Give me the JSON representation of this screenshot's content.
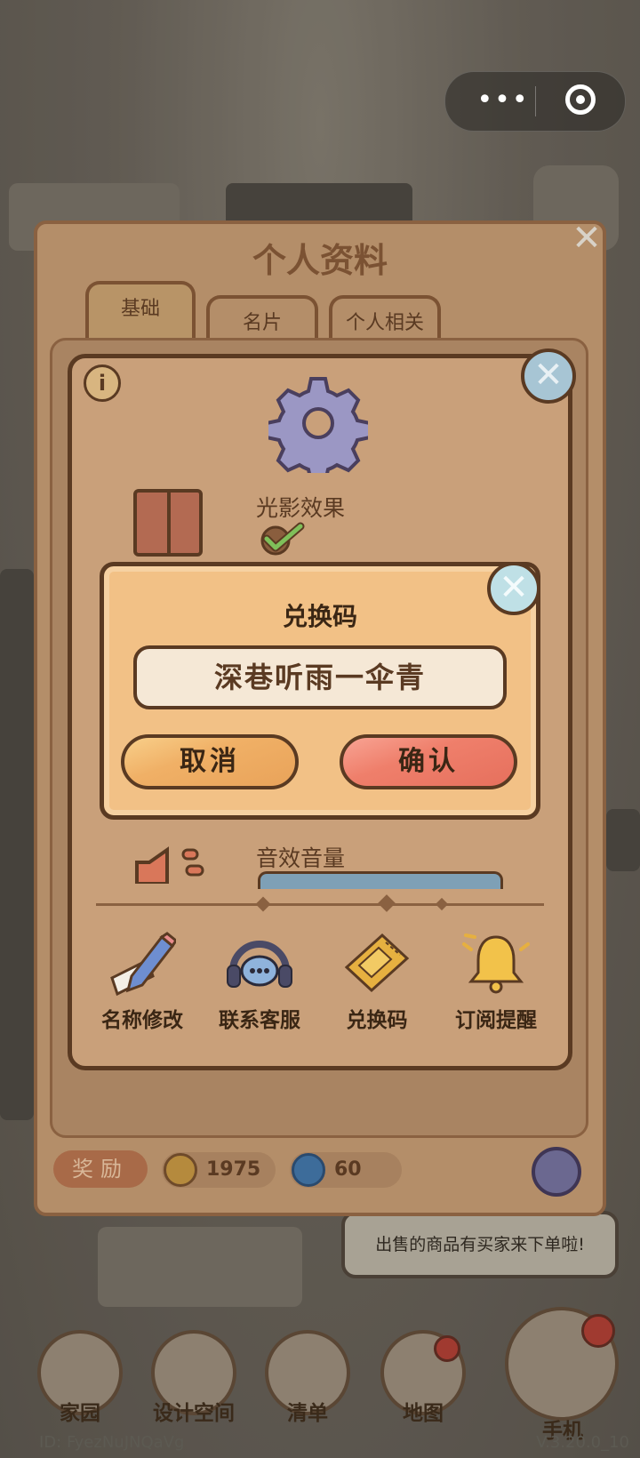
{
  "profile_panel": {
    "title": "个人资料",
    "tabs": [
      {
        "label": "基础"
      },
      {
        "label": "名片"
      },
      {
        "label": "个人相关"
      }
    ],
    "close_label": "✕",
    "rewards": {
      "label": "奖励",
      "coins": "1975",
      "gems": "60"
    }
  },
  "settings_dialog": {
    "close_label": "✕",
    "info_label": "i",
    "shadow_effect": {
      "label": "光影效果",
      "enabled": true
    },
    "sound_volume": {
      "label": "音效音量"
    },
    "actions": [
      {
        "label": "名称修改",
        "icon": "pencil-icon"
      },
      {
        "label": "联系客服",
        "icon": "headset-icon"
      },
      {
        "label": "兑换码",
        "icon": "ticket-icon"
      },
      {
        "label": "订阅提醒",
        "icon": "bell-icon"
      }
    ]
  },
  "redeem_dialog": {
    "title": "兑换码",
    "input_value": "深巷听雨一伞青",
    "cancel_label": "取消",
    "confirm_label": "确认",
    "close_label": "✕"
  },
  "notification": {
    "text": "出售的商品有买家来下单啦!"
  },
  "bottom_nav": [
    {
      "label": "家园"
    },
    {
      "label": "设计空间"
    },
    {
      "label": "清单"
    },
    {
      "label": "地图"
    },
    {
      "label": "手机"
    }
  ],
  "footer": {
    "user_id": "ID: FyezNuJNQaVg",
    "version": "V.3.20.0_10"
  },
  "colors": {
    "dialog_bg": "#f2c186",
    "outline": "#5a3a22",
    "cancel_button": "#f0b066",
    "confirm_button": "#ef7f6b",
    "settings_bg": "#c9a07a"
  }
}
